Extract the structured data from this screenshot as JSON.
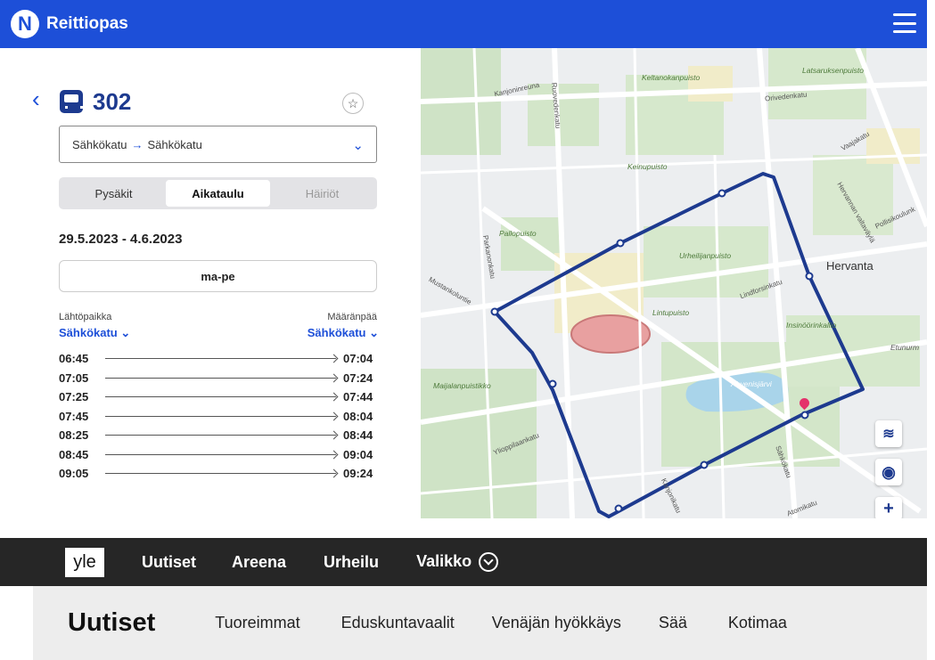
{
  "app": {
    "logo_letter": "N",
    "title": "Reittiopas"
  },
  "route": {
    "number": "302",
    "direction_from": "Sähkökatu",
    "direction_arrow": "→",
    "direction_to": "Sähkökatu",
    "tabs": [
      {
        "label": "Pysäkit",
        "state": "normal"
      },
      {
        "label": "Aikataulu",
        "state": "active"
      },
      {
        "label": "Häiriöt",
        "state": "disabled"
      }
    ],
    "date_range": "29.5.2023 - 4.6.2023",
    "day_button": "ma-pe",
    "origin_label": "Lähtöpaikka",
    "origin_stop": "Sähkökatu ⌄",
    "destination_label": "Määränpää",
    "destination_stop": "Sähkökatu ⌄",
    "schedule": [
      {
        "dep": "06:45",
        "arr": "07:04"
      },
      {
        "dep": "07:05",
        "arr": "07:24"
      },
      {
        "dep": "07:25",
        "arr": "07:44"
      },
      {
        "dep": "07:45",
        "arr": "08:04"
      },
      {
        "dep": "08:25",
        "arr": "08:44"
      },
      {
        "dep": "08:45",
        "arr": "09:04"
      },
      {
        "dep": "09:05",
        "arr": "09:24"
      }
    ]
  },
  "map": {
    "place_labels": [
      "Keltanokanpuisto",
      "Latsaruksenpuisto",
      "Keinupuisto",
      "Pallopuisto",
      "Urheilijanpuisto",
      "Lintupuisto",
      "Insinöörinkallio",
      "Maijalanpuistikko",
      "Ahvenisjärvi",
      "Etunurm"
    ],
    "street_labels": [
      "Kanjoninreuna",
      "Ruovedenkatu",
      "Orivedenkatu",
      "Vaajakatu",
      "Parkanonkatu",
      "Lindforsinkatu",
      "Mustankoluntie",
      "Ylioppilaankatu",
      "Kanjonikatu",
      "Sähkökatu",
      "Atomikatu",
      "Hervannan valtaväylä",
      "Pollisikoulunk"
    ],
    "district_label": "Hervanta",
    "route_color": "#1d3a8f"
  },
  "yle": {
    "logo": "yle",
    "nav": [
      "Uutiset",
      "Areena",
      "Urheilu",
      "Valikko"
    ],
    "section_title": "Uutiset",
    "section_links": [
      "Tuoreimmat",
      "Eduskuntavaalit",
      "Venäjän hyökkäys",
      "Sää",
      "Kotimaa"
    ]
  }
}
